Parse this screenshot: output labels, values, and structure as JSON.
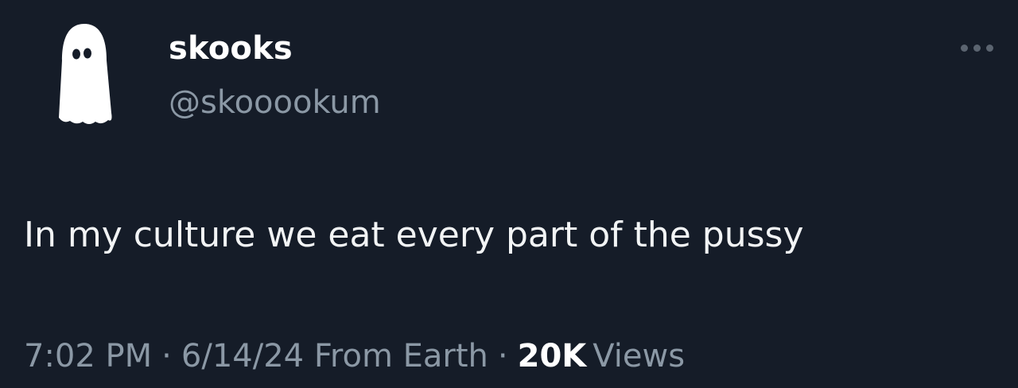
{
  "tweet": {
    "author": {
      "display_name": "skooks",
      "handle": "@skooookum",
      "avatar_icon": "ghost-icon"
    },
    "more_icon": "more-options-icon",
    "text": "In my culture we eat every part of the pussy",
    "meta": {
      "time": "7:02 PM",
      "date": "6/14/24",
      "source": "From Earth",
      "separator": "·",
      "views_count": "20K",
      "views_label": "Views"
    }
  },
  "colors": {
    "background": "#151c28",
    "primary_text": "#ffffff",
    "secondary_text": "#8b98a5"
  }
}
